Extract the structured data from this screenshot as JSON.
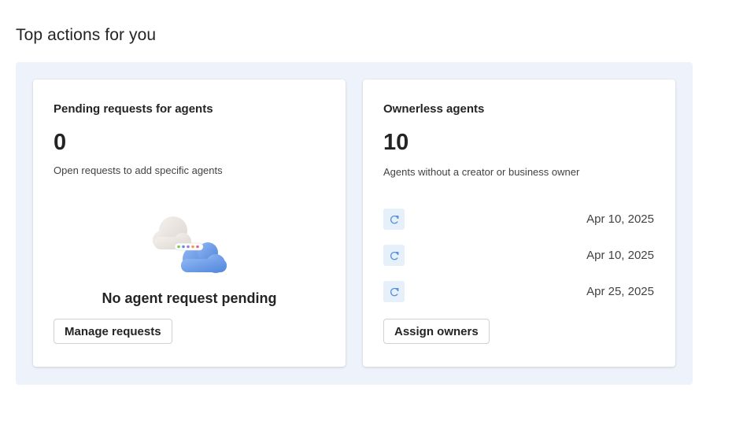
{
  "section": {
    "title": "Top actions for you"
  },
  "pending_card": {
    "title": "Pending requests for agents",
    "count": "0",
    "description": "Open requests to add specific agents",
    "empty_message": "No agent request pending",
    "button_label": "Manage requests"
  },
  "ownerless_card": {
    "title": "Ownerless agents",
    "count": "10",
    "description": "Agents without a creator or business owner",
    "items": [
      {
        "icon": "agent-icon",
        "date": "Apr 10, 2025"
      },
      {
        "icon": "agent-icon",
        "date": "Apr 10, 2025"
      },
      {
        "icon": "agent-icon",
        "date": "Apr 25, 2025"
      }
    ],
    "button_label": "Assign owners"
  },
  "colors": {
    "panel_bg": "#eef2fb",
    "icon_bg": "#e6f0fa",
    "icon_stroke": "#5b8fd6",
    "text": "#242424"
  }
}
